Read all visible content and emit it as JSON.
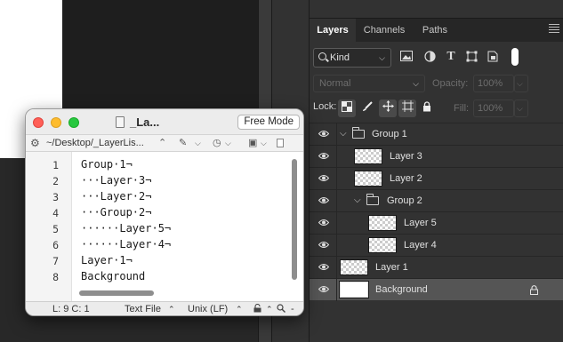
{
  "editor": {
    "title": "_La...",
    "mode_button": "Free Mode",
    "path": "~/Desktop/_LayerLis...",
    "line_numbers": [
      "1",
      "2",
      "3",
      "4",
      "5",
      "6",
      "7",
      "8"
    ],
    "lines": [
      "Group·1¬",
      "···Layer·3¬",
      "···Layer·2¬",
      "···Group·2¬",
      "······Layer·5¬",
      "······Layer·4¬",
      "Layer·1¬",
      "Background"
    ],
    "status": {
      "position": "L: 9 C: 1",
      "syntax": "Text File",
      "line_endings": "Unix (LF)"
    }
  },
  "layers_panel": {
    "tabs": [
      "Layers",
      "Channels",
      "Paths"
    ],
    "filter_kind": "Kind",
    "blend_mode": "Normal",
    "opacity_label": "Opacity:",
    "opacity_value": "100%",
    "lock_label": "Lock:",
    "fill_label": "Fill:",
    "fill_value": "100%",
    "layers": [
      {
        "name": "Group 1",
        "type": "group",
        "indent": 0
      },
      {
        "name": "Layer 3",
        "type": "layer",
        "indent": 1
      },
      {
        "name": "Layer 2",
        "type": "layer",
        "indent": 1
      },
      {
        "name": "Group 2",
        "type": "group",
        "indent": 1
      },
      {
        "name": "Layer 5",
        "type": "layer",
        "indent": 2
      },
      {
        "name": "Layer 4",
        "type": "layer",
        "indent": 2
      },
      {
        "name": "Layer 1",
        "type": "layer",
        "indent": 0
      },
      {
        "name": "Background",
        "type": "background",
        "indent": 0,
        "locked": true,
        "selected": true
      }
    ]
  },
  "colors": {
    "panel_bg": "#323232",
    "selected_row": "#555555",
    "close": "#ff5f57",
    "minimize": "#febc2e",
    "maximize": "#28c840"
  }
}
